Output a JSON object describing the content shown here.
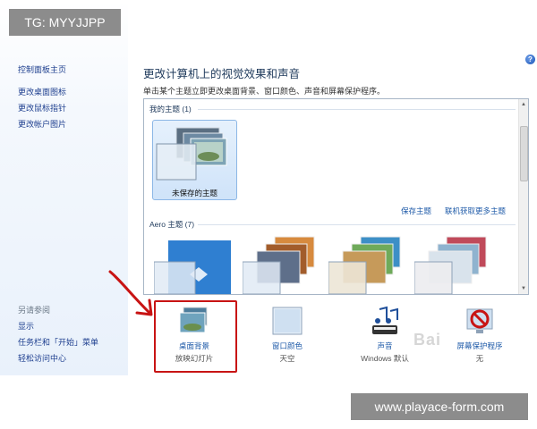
{
  "sidebar": {
    "home": "控制面板主页",
    "links": [
      "更改桌面图标",
      "更改鼠标指针",
      "更改帐户图片"
    ],
    "see_also_heading": "另请参阅",
    "see_also": [
      "显示",
      "任务栏和「开始」菜单",
      "轻松访问中心"
    ]
  },
  "main": {
    "title": "更改计算机上的视觉效果和声音",
    "subtitle": "单击某个主题立即更改桌面背景、窗口颜色、声音和屏幕保护程序。",
    "help_glyph": "?"
  },
  "themes": {
    "my_themes_label": "我的主题 (1)",
    "unsaved_theme": "未保存的主题",
    "save_theme": "保存主题",
    "get_more_online": "联机获取更多主题",
    "aero_label": "Aero 主题 (7)"
  },
  "bottom": [
    {
      "label": "桌面背景",
      "sub": "放映幻灯片",
      "icon": "desktop-background-icon"
    },
    {
      "label": "窗口颜色",
      "sub": "天空",
      "icon": "window-color-icon"
    },
    {
      "label": "声音",
      "sub": "Windows 默认",
      "icon": "sounds-icon"
    },
    {
      "label": "屏幕保护程序",
      "sub": "无",
      "icon": "screen-saver-icon"
    }
  ],
  "overlays": {
    "top_left": "TG: MYYJJPP",
    "bottom_right": "www.playace-form.com",
    "watermark": "Bai"
  },
  "colors": {
    "accent": "#1e5aa8",
    "annotation": "#c81414"
  }
}
